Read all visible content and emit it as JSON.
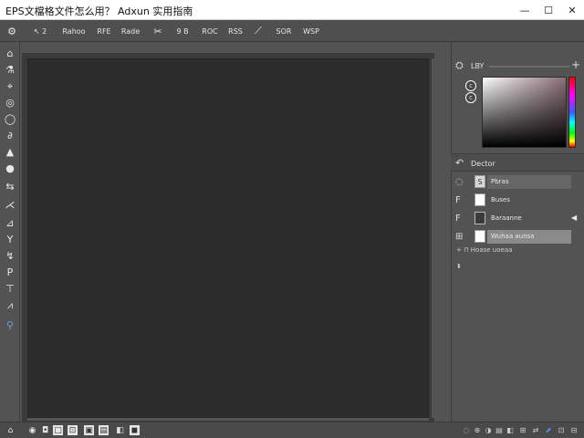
{
  "window": {
    "title": "EPS文檔格文件怎么用？ Adxun 实用指南",
    "minimize": "—",
    "maximize": "☐",
    "close": "✕"
  },
  "options_bar": {
    "items": [
      {
        "label": "⚙",
        "icon": "home-icon"
      },
      {
        "label": "↖ 2",
        "icon": "move-tool-icon"
      },
      {
        "label": "Rahoo"
      },
      {
        "label": "RFE"
      },
      {
        "label": "Rade"
      },
      {
        "label": "✂"
      },
      {
        "label": "9 B"
      },
      {
        "label": "ROC"
      },
      {
        "label": "RSS"
      },
      {
        "label": "⟋"
      },
      {
        "label": "SOR"
      },
      {
        "label": "WSP"
      }
    ]
  },
  "tools": [
    {
      "glyph": "⌂",
      "icon": "home-tool-icon"
    },
    {
      "glyph": "⚗",
      "icon": "flask-icon"
    },
    {
      "glyph": "⌖",
      "icon": "target-icon"
    },
    {
      "glyph": "◎",
      "icon": "lasso-icon"
    },
    {
      "glyph": "◯",
      "icon": "ellipse-icon"
    },
    {
      "glyph": "∂",
      "icon": "brush-icon"
    },
    {
      "glyph": "▲",
      "icon": "triangle-icon"
    },
    {
      "glyph": "●",
      "icon": "dot-icon"
    },
    {
      "glyph": "⇆",
      "icon": "swap-icon"
    },
    {
      "glyph": "⋌",
      "icon": "path-icon"
    },
    {
      "glyph": "⊿",
      "icon": "pen-icon"
    },
    {
      "glyph": "Y",
      "icon": "y-tool-icon"
    },
    {
      "glyph": "↯",
      "icon": "bolt-icon"
    },
    {
      "glyph": "P",
      "icon": "p-tool-icon"
    },
    {
      "glyph": "⊤",
      "icon": "text-tool-icon"
    },
    {
      "glyph": "⩘",
      "icon": "ruler-icon"
    },
    {
      "glyph": "⚲",
      "icon": "hand-tool-icon"
    }
  ],
  "color_panel": {
    "header_icon": "⛭",
    "label": "LBY",
    "add": "+",
    "fg_label": "c",
    "bg_label": "c"
  },
  "layers_panel": {
    "header_icon": "↶",
    "label": "Dector",
    "rows": [
      {
        "eye": "◌",
        "name": "Pbras",
        "thumb": "icon"
      },
      {
        "eye": "F",
        "name": "Buses",
        "thumb": "white"
      },
      {
        "eye": "F",
        "name": "Baraanne",
        "thumb": "dark",
        "arrow": "◀"
      },
      {
        "eye": "⊞",
        "name": "Wuhaa aunsa",
        "thumb": "white",
        "selected": true
      }
    ],
    "footer1": "+ ⊓ Hoase uoeaa",
    "footer2": "⬍"
  },
  "status_left": [
    "⌂",
    "◉",
    "◘",
    "□",
    "⊡",
    "▣",
    "▤",
    "◧",
    "◼"
  ],
  "status_right": [
    "◌",
    "⊕",
    "◑",
    "▤",
    "◧",
    "⊞",
    "⇄",
    "⬈",
    "⊡",
    "⊟"
  ]
}
